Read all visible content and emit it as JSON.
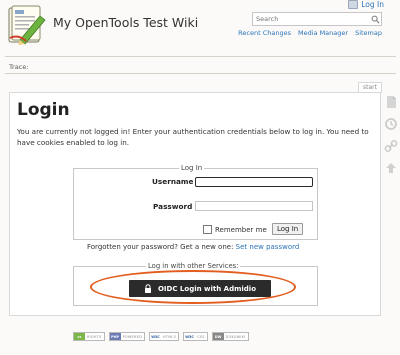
{
  "header": {
    "login_link": "Log In",
    "wiki_title": "My OpenTools Test Wiki",
    "search_placeholder": "Search",
    "tools": [
      "Recent Changes",
      "Media Manager",
      "Sitemap"
    ]
  },
  "breadcrumb": {
    "label": "Trace:"
  },
  "page": {
    "tab": "start",
    "heading": "Login",
    "intro": "You are currently not logged in! Enter your authentication credentials below to log in. You need to have cookies enabled to log in."
  },
  "login_form": {
    "legend": "Log In",
    "username_label": "Username",
    "username_value": "",
    "password_label": "Password",
    "password_value": "",
    "remember_label": "Remember me",
    "submit_label": "Log In"
  },
  "forgot": {
    "text": "Forgotten your password? Get a new one: ",
    "link": "Set new password"
  },
  "services": {
    "legend": "Log in with other Services:",
    "oidc_button": "OIDC Login with Admidio"
  },
  "badges": [
    {
      "k": "cc",
      "v": "RIGHTS",
      "color": "#7ab648"
    },
    {
      "k": "PHP",
      "v": "POWERED",
      "color": "#6b7bb5"
    },
    {
      "k": "W3C",
      "v": "HTML5",
      "color": "#2e5c9a"
    },
    {
      "k": "W3C",
      "v": "CSS",
      "color": "#2e5c9a"
    },
    {
      "k": "DW",
      "v": "DOKUWIKI",
      "color": "#888888"
    }
  ],
  "colors": {
    "link": "#2b73b7",
    "highlight_ring": "#e35d1e",
    "oidc_button_bg": "#2b2b2b"
  }
}
